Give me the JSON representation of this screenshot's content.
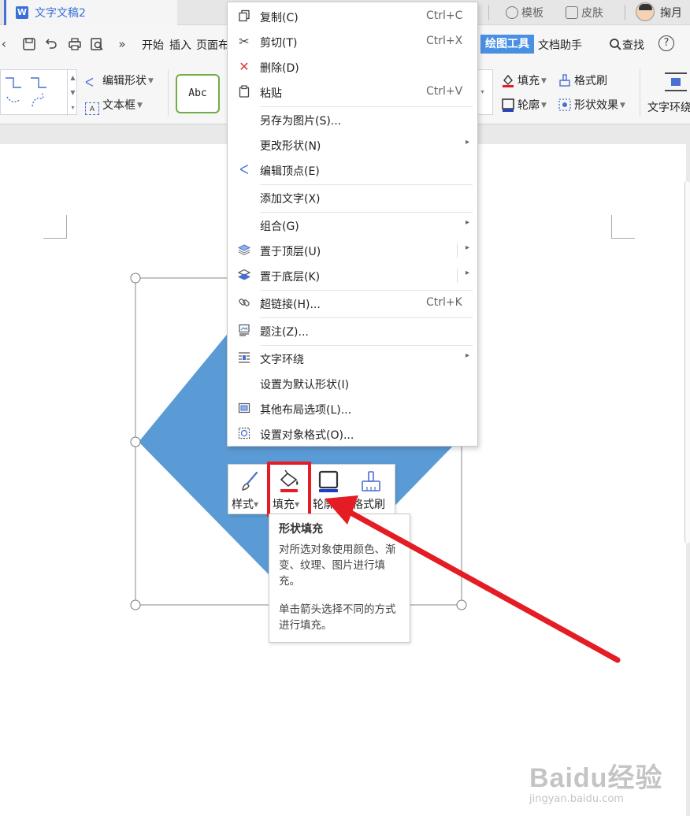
{
  "titlebar": {
    "doc_name": "文字文稿2",
    "templates": "模板",
    "skins": "皮肤",
    "user": "掬月",
    "icon_letter": "W"
  },
  "menubar": {
    "tabs": [
      "开始",
      "插入",
      "页面布"
    ],
    "active_tab": "绘图工具",
    "assistant_tab": "文档助手",
    "search": "查找",
    "help": "?"
  },
  "ribbon": {
    "edit_shape": "编辑形状",
    "text_box": "文本框",
    "style_sample": "Abc",
    "fill": "填充",
    "format_painter": "格式刷",
    "outline": "轮廓",
    "shape_effects": "形状效果",
    "text_wrap": "文字环绕"
  },
  "context_menu": {
    "items": [
      {
        "label": "复制(C)",
        "shortcut": "Ctrl+C",
        "icon": "copy-icon"
      },
      {
        "label": "剪切(T)",
        "shortcut": "Ctrl+X",
        "icon": "scissors-icon"
      },
      {
        "label": "删除(D)",
        "shortcut": "",
        "icon": "delete-icon"
      },
      {
        "label": "粘贴",
        "shortcut": "Ctrl+V",
        "icon": "paste-icon"
      },
      {
        "label": "另存为图片(S)...",
        "shortcut": "",
        "icon": ""
      },
      {
        "label": "更改形状(N)",
        "shortcut": "",
        "icon": ""
      },
      {
        "label": "编辑顶点(E)",
        "shortcut": "",
        "icon": "edit-points-icon"
      },
      {
        "label": "添加文字(X)",
        "shortcut": "",
        "icon": ""
      },
      {
        "label": "组合(G)",
        "shortcut": "",
        "icon": ""
      },
      {
        "label": "置于顶层(U)",
        "shortcut": "",
        "icon": "bring-to-front-icon"
      },
      {
        "label": "置于底层(K)",
        "shortcut": "",
        "icon": "send-to-back-icon"
      },
      {
        "label": "超链接(H)...",
        "shortcut": "Ctrl+K",
        "icon": "hyperlink-icon"
      },
      {
        "label": "题注(Z)...",
        "shortcut": "",
        "icon": "caption-icon"
      },
      {
        "label": "文字环绕",
        "shortcut": "",
        "icon": "text-wrap-icon"
      },
      {
        "label": "设置为默认形状(I)",
        "shortcut": "",
        "icon": ""
      },
      {
        "label": "其他布局选项(L)...",
        "shortcut": "",
        "icon": "layout-options-icon"
      },
      {
        "label": "设置对象格式(O)...",
        "shortcut": "",
        "icon": "format-object-icon"
      }
    ]
  },
  "mini_toolbar": {
    "style": "样式",
    "fill": "填充",
    "outline": "轮廓",
    "format_painter": "格式刷"
  },
  "tooltip": {
    "title": "形状填充",
    "body": "对所选对象使用颜色、渐变、纹理、图片进行填充。",
    "hint": "单击箭头选择不同的方式进行填充。"
  },
  "watermark": {
    "logo": "Baidu经验",
    "site": "jingyan.baidu.com"
  },
  "colors": {
    "shape_fill": "#5b9bd5",
    "highlight": "#e41c23",
    "accent": "#4a90e2",
    "style_border": "#70ad47"
  }
}
